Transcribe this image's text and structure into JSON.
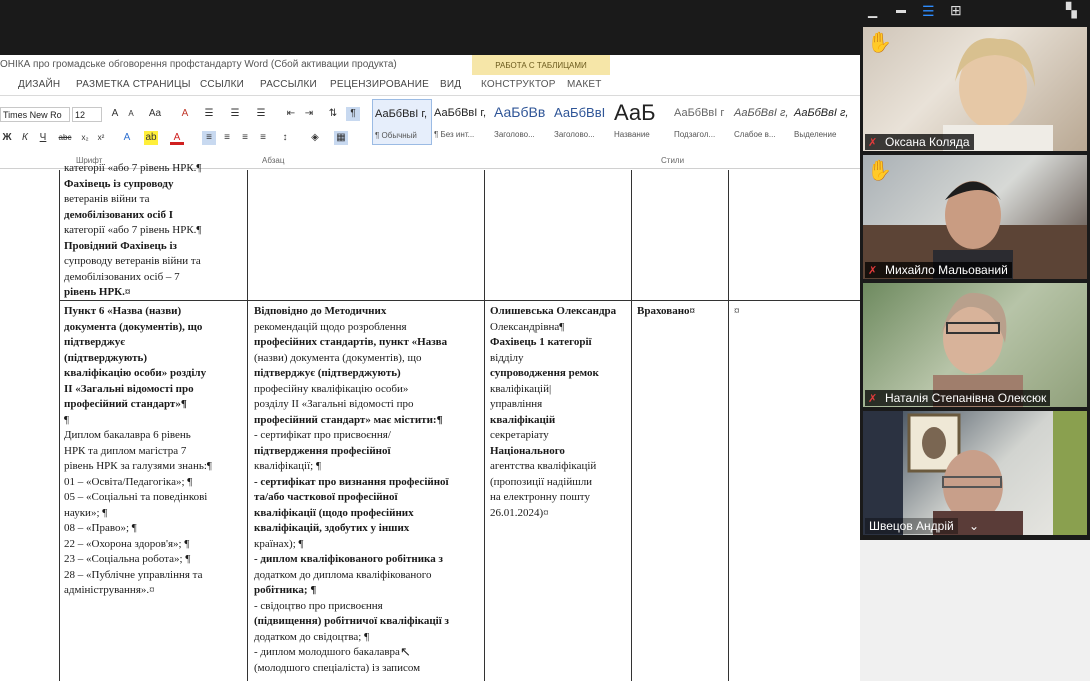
{
  "zoom_controls": {
    "minimize_icon": "minus-icon",
    "layout_icons": [
      "minimize-video-icon",
      "speaker-view-icon",
      "grid-view-icon"
    ],
    "panel_icon": "side-panel-icon"
  },
  "word": {
    "title": "ОНІКА про громадське обговорення профстандарту   Word (Сбой активации продукта)",
    "tables_tools_label": "РАБОТА С ТАБЛИЦАМИ",
    "tabs": [
      "ДИЗАЙН",
      "РАЗМЕТКА СТРАНИЦЫ",
      "ССЫЛКИ",
      "РАССЫЛКИ",
      "РЕЦЕНЗИРОВАНИЕ",
      "ВИД",
      "КОНСТРУКТОР",
      "МАКЕТ"
    ],
    "font_name": "Times New Ro",
    "font_size": "12",
    "groups": [
      "Шрифт",
      "Абзац",
      "Стили"
    ],
    "styles": [
      {
        "sample": "АаБбВвІ г,",
        "name": "¶ Обычный"
      },
      {
        "sample": "АаБбВвІ г,",
        "name": "¶ Без инт..."
      },
      {
        "sample": "АаБбВв",
        "name": "Заголово..."
      },
      {
        "sample": "АаБбВвІ",
        "name": "Заголово..."
      },
      {
        "sample": "АаБ",
        "name": "Название"
      },
      {
        "sample": "АаБбВвІ г",
        "name": "Подзагол..."
      },
      {
        "sample": "АаБбВвІ г,",
        "name": "Слабое в..."
      },
      {
        "sample": "АаБбВвІ г,",
        "name": "Выделение"
      }
    ]
  },
  "document": {
    "top_row_col1": [
      "категорії   «або 7 рівень НРК.¶",
      "Фахівець із супроводу",
      "ветеранів війни та",
      "демобілізованих осіб І",
      "категорії   «або 7 рівень НРК.¶",
      "Провідний Фахівець із",
      "супроводу ветеранів війни та",
      "демобілізованих осіб – 7",
      "рівень НРК.¤"
    ],
    "col1": [
      "Пункт 6 «Назва (назви)",
      "документа (документів), що",
      "підтверджує",
      "(підтверджують)",
      "кваліфікацію особи» розділу",
      "II «Загальні відомості про",
      "професійний стандарт»¶",
      "¶",
      "Диплом бакалавра 6 рівень",
      "НРК та диплом магістра 7",
      "рівень НРК за галузями знань:¶",
      "01 – «Освіта/Педагогіка»; ¶",
      "05 – «Соціальні та поведінкові",
      "науки»; ¶",
      "08 – «Право»; ¶",
      "22 – «Охорона здоров'я»; ¶",
      "23 – «Соціальна робота»; ¶",
      "28 – «Публічне управління та",
      "адміністрування».¤"
    ],
    "col2": [
      "Відповідно до Методичних",
      "рекомендацій щодо розроблення",
      "професійних стандартів, пункт «Назва",
      "(назви) документа (документів), що",
      "підтверджує (підтверджують)",
      "професійну кваліфікацію особи»",
      "розділу II «Загальні відомості про",
      "професійний стандарт» має містити:¶",
      "- сертифікат про присвоєння/",
      "підтвердження професійної",
      "кваліфікації; ¶",
      "- сертифікат про визнання професійної",
      "та/або часткової професійної",
      "кваліфікації (щодо професійних",
      "кваліфікацій, здобутих у інших",
      "країнах); ¶",
      "- диплом кваліфікованого робітника з",
      "додатком до диплома кваліфікованого",
      "робітника; ¶",
      "- свідоцтво про присвоєння",
      "(підвищення) робітничої кваліфікації з",
      "додатком до свідоцтва; ¶",
      "- диплом молодшого бакалавра",
      "(молодшого спеціаліста) із записом"
    ],
    "col3": [
      "Олишевська Олександра",
      "Олександрівна¶",
      "Фахівець 1 категорії",
      "відділу",
      "супроводження ремок",
      "кваліфікацій|",
      "управління",
      "кваліфікацій",
      "секретаріату",
      "Національного",
      "агентства кваліфікацій",
      "(пропозиції надійшли",
      "на електронну пошту",
      "26.01.2024)¤"
    ],
    "col4": "Враховано¤",
    "col5": "¤"
  },
  "participants": [
    {
      "name": "Оксана Коляда",
      "hand_raised": true,
      "muted": true
    },
    {
      "name": "Михайло Мальований",
      "hand_raised": true,
      "muted": true
    },
    {
      "name": "Наталія Степанівна Олексюк",
      "hand_raised": false,
      "muted": true
    },
    {
      "name": "Швецов Андрій",
      "hand_raised": false,
      "muted": false
    }
  ],
  "colors": {
    "zoom_bg": "#1a1a1a",
    "active_layout": "#2d8cff",
    "hand": "#f5c518",
    "mute": "#e23b3b"
  }
}
